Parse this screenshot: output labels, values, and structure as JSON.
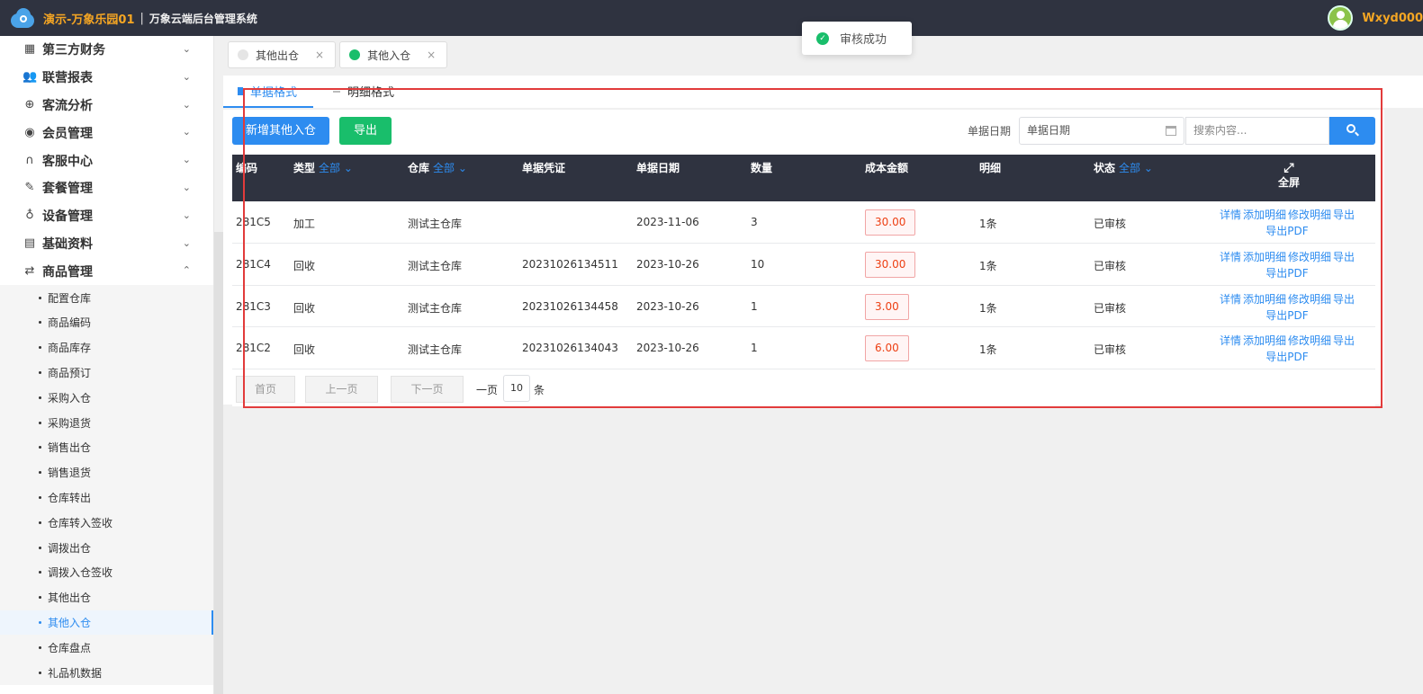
{
  "header": {
    "brand": "演示-万象乐园01",
    "separator": "|",
    "system_name": "万象云端后台管理系统",
    "username": "Wxyd000"
  },
  "toast": {
    "text": "审核成功",
    "icon": "check-circle-icon"
  },
  "sidebar": {
    "items": [
      {
        "label": "第三方财务",
        "icon": "calculator-icon",
        "glyph": "▦"
      },
      {
        "label": "联营报表",
        "icon": "users-icon",
        "glyph": "👥"
      },
      {
        "label": "客流分析",
        "icon": "target-icon",
        "glyph": "⊕"
      },
      {
        "label": "会员管理",
        "icon": "user-icon",
        "glyph": "◉"
      },
      {
        "label": "客服中心",
        "icon": "headset-icon",
        "glyph": "∩"
      },
      {
        "label": "套餐管理",
        "icon": "edit-icon",
        "glyph": "✎"
      },
      {
        "label": "设备管理",
        "icon": "stethoscope-icon",
        "glyph": "♁"
      },
      {
        "label": "基础资料",
        "icon": "file-icon",
        "glyph": "▤"
      },
      {
        "label": "商品管理",
        "icon": "exchange-icon",
        "glyph": "⇄"
      }
    ],
    "expanded_chevron": "⌃",
    "collapsed_chevron": "⌄",
    "sub_items": [
      "配置仓库",
      "商品编码",
      "商品库存",
      "商品预订",
      "采购入仓",
      "采购退货",
      "销售出仓",
      "销售退货",
      "仓库转出",
      "仓库转入签收",
      "调拨出仓",
      "调拨入仓签收",
      "其他出仓",
      "其他入仓",
      "仓库盘点",
      "礼品机数据"
    ],
    "active_sub_item": "其他入仓"
  },
  "page_tabs": [
    {
      "label": "其他出仓",
      "active": false
    },
    {
      "label": "其他入仓",
      "active": true
    }
  ],
  "close_glyph": "×",
  "view_tabs": {
    "tab1": "单据格式",
    "tab2": "明细格式"
  },
  "toolbar": {
    "add_label": "新增其他入仓",
    "export_label": "导出",
    "date_label": "单据日期",
    "date_placeholder": "单据日期",
    "search_placeholder": "搜索内容..."
  },
  "table": {
    "headers": {
      "code": "编码",
      "type": "类型",
      "warehouse": "仓库",
      "voucher": "单据凭证",
      "date": "单据日期",
      "quantity": "数量",
      "cost": "成本金额",
      "detail": "明细",
      "status": "状态",
      "filter_all": "全部",
      "fullscreen": "全屏"
    },
    "rows": [
      {
        "code": "281C5",
        "type": "加工",
        "warehouse": "测试主仓库",
        "voucher": "",
        "date": "2023-11-06",
        "quantity": "3",
        "cost": "30.00",
        "detail": "1条",
        "status": "已审核"
      },
      {
        "code": "281C4",
        "type": "回收",
        "warehouse": "测试主仓库",
        "voucher": "20231026134511",
        "date": "2023-10-26",
        "quantity": "10",
        "cost": "30.00",
        "detail": "1条",
        "status": "已审核"
      },
      {
        "code": "281C3",
        "type": "回收",
        "warehouse": "测试主仓库",
        "voucher": "20231026134458",
        "date": "2023-10-26",
        "quantity": "1",
        "cost": "3.00",
        "detail": "1条",
        "status": "已审核"
      },
      {
        "code": "281C2",
        "type": "回收",
        "warehouse": "测试主仓库",
        "voucher": "20231026134043",
        "date": "2023-10-26",
        "quantity": "1",
        "cost": "6.00",
        "detail": "1条",
        "status": "已审核"
      }
    ],
    "ops": {
      "detail": "详情",
      "add_detail": "添加明细",
      "edit_detail": "修改明细",
      "export": "导出",
      "export_pdf": "导出PDF"
    }
  },
  "pager": {
    "first": "首页",
    "prev": "上一页",
    "next": "下一页",
    "per_page_label": "一页",
    "per_page_value": "10",
    "unit": "条"
  },
  "colors": {
    "primary": "#2d8cf0",
    "success": "#19be6b",
    "header_dark": "#2f3340",
    "brand": "#f5a623",
    "danger": "#e23b3b"
  }
}
